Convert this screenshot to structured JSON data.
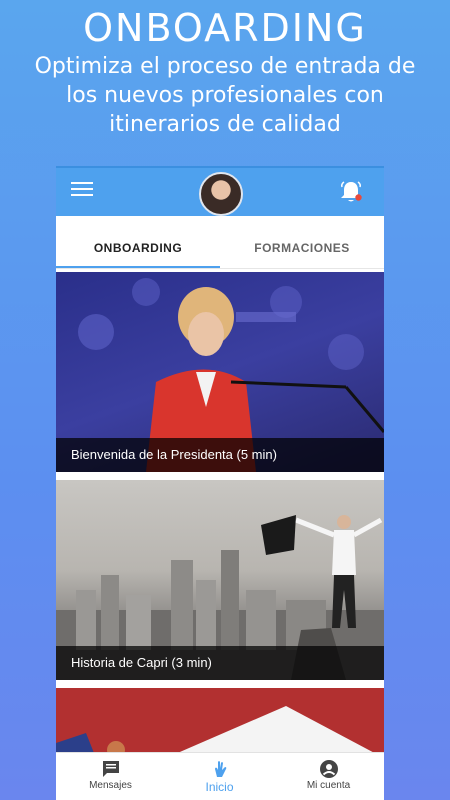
{
  "promo": {
    "title": "ONBOARDING",
    "subtitle": "Optimiza el proceso de entrada de los nuevos profesionales con itinerarios de calidad"
  },
  "app_bar": {
    "menu_icon": "menu-icon",
    "avatar": "avatar",
    "bell_icon": "bell-icon",
    "accent_color": "#4ea1ee"
  },
  "tabs": [
    {
      "label": "ONBOARDING",
      "active": true
    },
    {
      "label": "FORMACIONES",
      "active": false
    }
  ],
  "cards": [
    {
      "caption": "Bienvenida de la Presidenta (5 min)"
    },
    {
      "caption": "Historia de Capri (3 min)"
    },
    {
      "caption": ""
    }
  ],
  "bottom_nav": [
    {
      "label": "Mensajes",
      "icon": "chat-icon"
    },
    {
      "label": "Inicio",
      "icon": "hand-icon",
      "active": true
    },
    {
      "label": "Mi cuenta",
      "icon": "account-icon"
    }
  ]
}
